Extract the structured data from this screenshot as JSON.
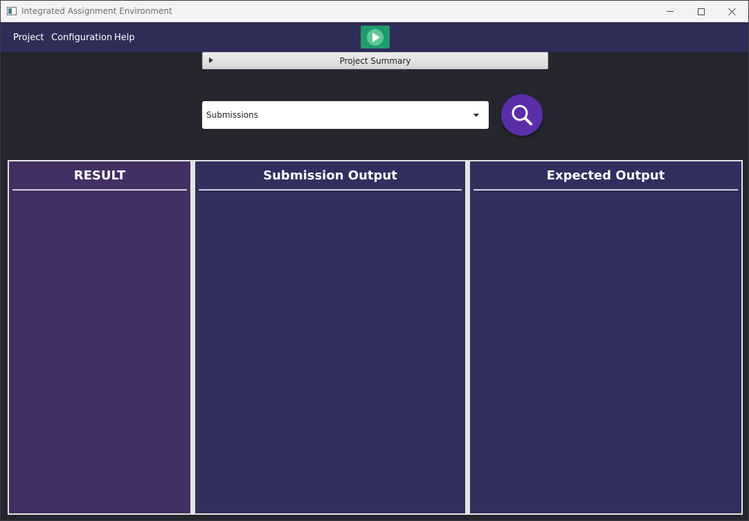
{
  "window": {
    "title": "Integrated Assignment Environment"
  },
  "menubar": {
    "items": [
      {
        "label": "Project"
      },
      {
        "label": "Configuration"
      },
      {
        "label": "Help"
      }
    ],
    "run_icon": "play-icon"
  },
  "summary": {
    "title": "Project Summary",
    "expanded": false
  },
  "submissions": {
    "selected": "Submissions"
  },
  "search": {
    "icon": "search-icon"
  },
  "panels": {
    "result": {
      "title": "RESULT"
    },
    "submission_output": {
      "title": "Submission Output"
    },
    "expected_output": {
      "title": "Expected Output"
    }
  },
  "colors": {
    "menubar": "#2f2c58",
    "run_button": "#1f9a6e",
    "search_button": "#5a2ea8",
    "result_panel": "#432f63",
    "output_panel": "#312f5e",
    "background": "#26262f"
  }
}
